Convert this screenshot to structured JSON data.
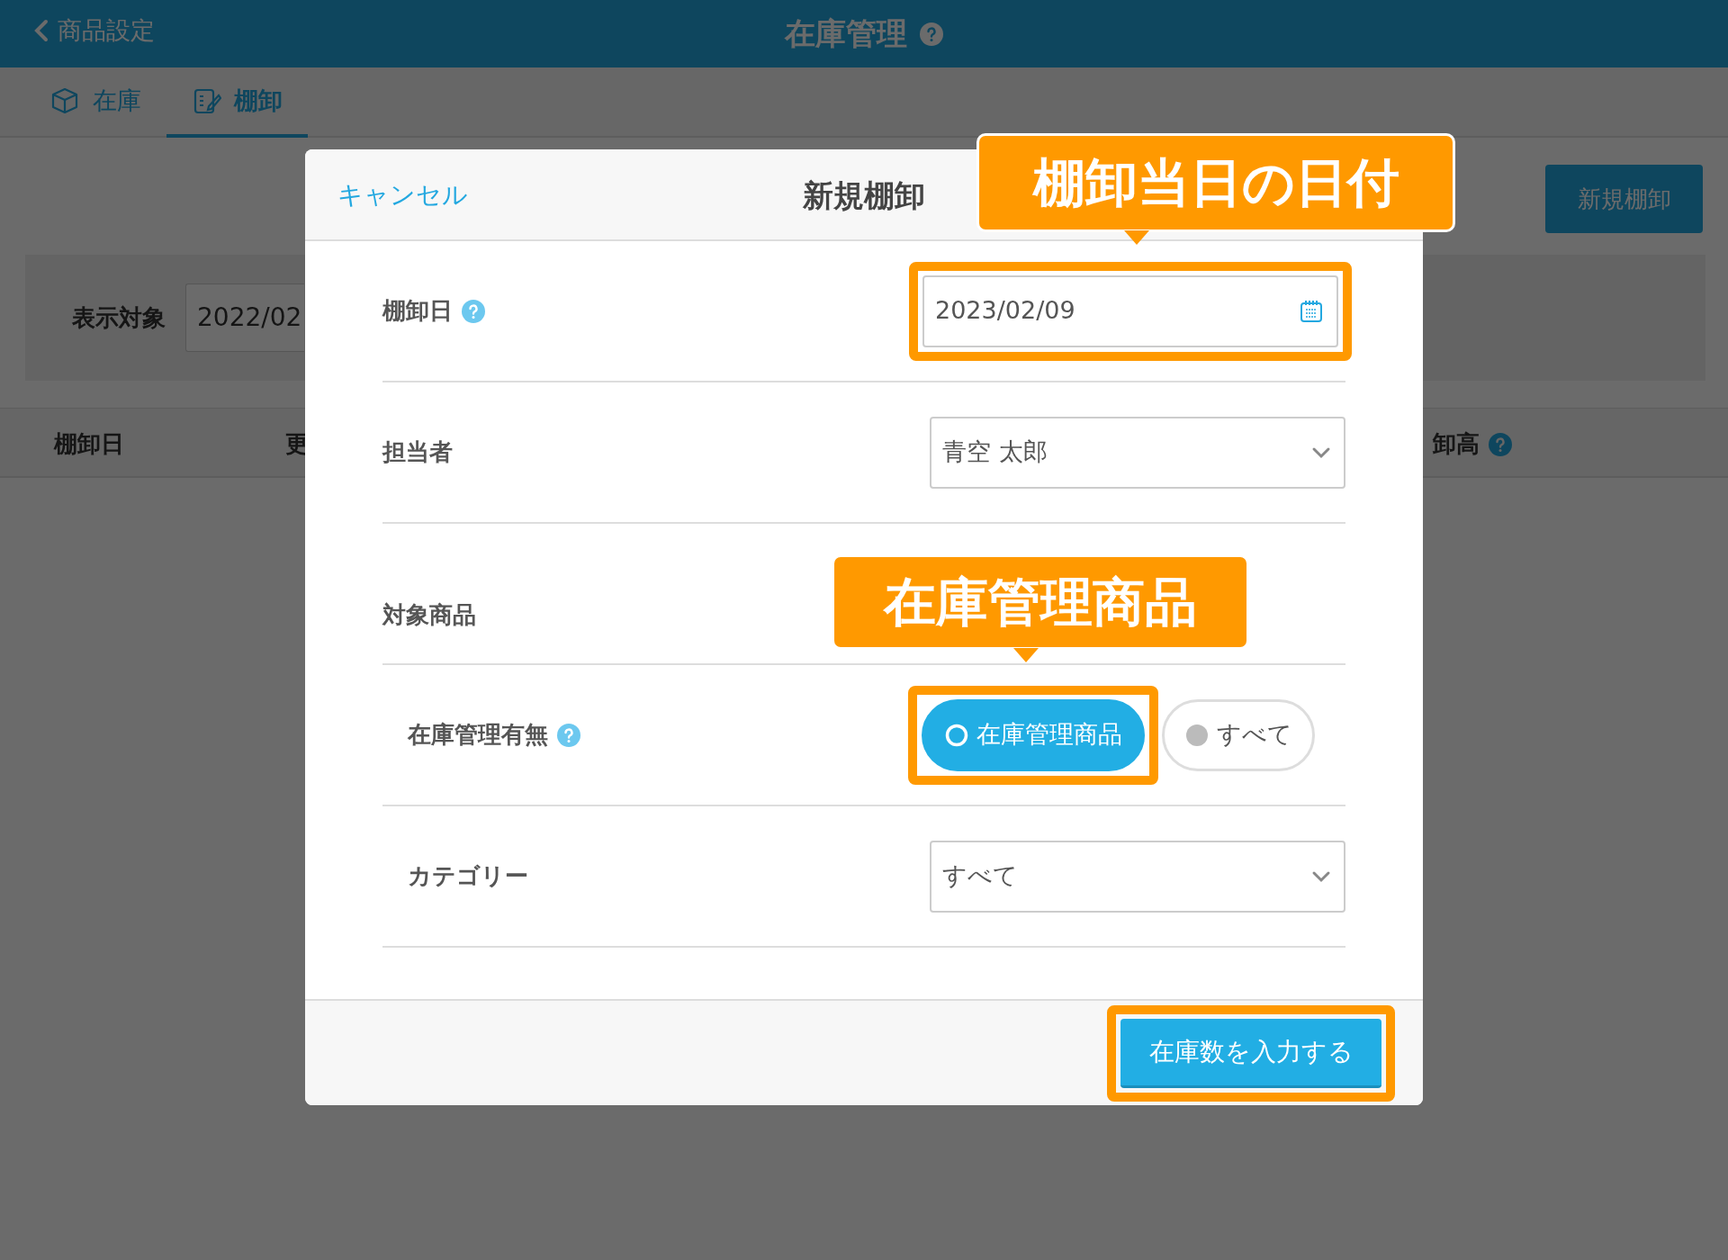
{
  "header": {
    "back_label": "商品設定",
    "title": "在庫管理",
    "help": true
  },
  "tabs": [
    {
      "label": "在庫",
      "selected": false,
      "kind": "box"
    },
    {
      "label": "棚卸",
      "selected": true,
      "kind": "clipboard"
    }
  ],
  "new_button": "新規棚卸",
  "filter": {
    "label": "表示対象",
    "value": "2022/02"
  },
  "table": {
    "columns": [
      {
        "label": "棚卸日",
        "help": false
      },
      {
        "label": "更",
        "help": false
      },
      {
        "label": "卸高",
        "help": true
      }
    ]
  },
  "modal": {
    "cancel": "キャンセル",
    "title": "新規棚卸",
    "fields": [
      {
        "kind": "date",
        "label": "棚卸日",
        "help": true,
        "value": "2023/02/09",
        "highlighted": true
      },
      {
        "kind": "select",
        "label": "担当者",
        "help": false,
        "value": "青空 太郎"
      },
      {
        "kind": "section",
        "label": "対象商品",
        "children": [
          {
            "kind": "toggle",
            "label": "在庫管理有無",
            "help": true,
            "options": [
              {
                "label": "在庫管理商品",
                "selected": true,
                "highlighted": true
              },
              {
                "label": "すべて",
                "selected": false,
                "highlighted": false
              }
            ]
          },
          {
            "kind": "select",
            "label": "カテゴリー",
            "help": false,
            "value": "すべて"
          }
        ]
      }
    ],
    "submit": {
      "label": "在庫数を入力する",
      "highlighted": true
    }
  },
  "callouts": [
    {
      "text": "棚卸当日の日付"
    },
    {
      "text": "在庫管理商品"
    }
  ]
}
